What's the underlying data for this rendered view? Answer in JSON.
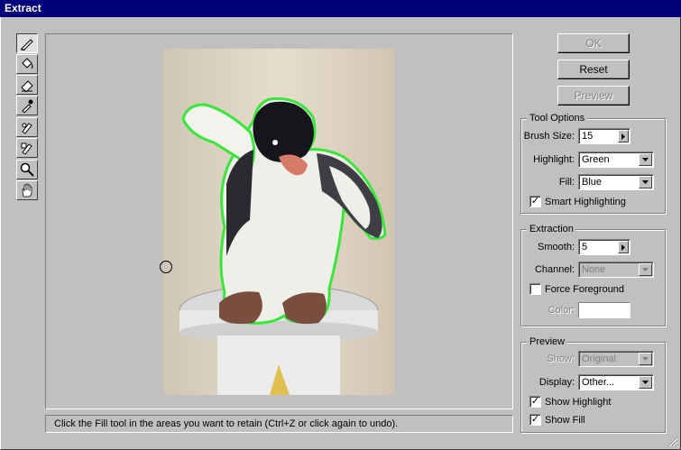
{
  "window": {
    "title": "Extract"
  },
  "tools": [
    {
      "name": "edge-highlighter-tool",
      "icon": "marker-icon"
    },
    {
      "name": "fill-tool",
      "icon": "paint-bucket-icon"
    },
    {
      "name": "eraser-tool",
      "icon": "eraser-icon"
    },
    {
      "name": "eyedropper-tool",
      "icon": "eyedropper-icon"
    },
    {
      "name": "cleanup-tool",
      "icon": "cleanup-icon"
    },
    {
      "name": "edge-touchup-tool",
      "icon": "edge-touchup-icon"
    },
    {
      "name": "zoom-tool",
      "icon": "magnifier-icon"
    },
    {
      "name": "hand-tool",
      "icon": "hand-icon"
    }
  ],
  "buttons": {
    "ok": "OK",
    "reset": "Reset",
    "preview": "Preview"
  },
  "tool_options": {
    "title": "Tool Options",
    "brush_size_label": "Brush Size:",
    "brush_size_value": "15",
    "highlight_label": "Highlight:",
    "highlight_value": "Green",
    "fill_label": "Fill:",
    "fill_value": "Blue",
    "smart_highlighting_label": "Smart Highlighting",
    "smart_highlighting_checked": true
  },
  "extraction": {
    "title": "Extraction",
    "smooth_label": "Smooth:",
    "smooth_value": "5",
    "channel_label": "Channel:",
    "channel_value": "None",
    "force_foreground_label": "Force Foreground",
    "force_foreground_checked": false,
    "color_label": "Color:"
  },
  "preview": {
    "title": "Preview",
    "show_label": "Show:",
    "show_value": "Original",
    "display_label": "Display:",
    "display_value": "Other...",
    "show_highlight_label": "Show Highlight",
    "show_highlight_checked": true,
    "show_fill_label": "Show Fill",
    "show_fill_checked": true
  },
  "status": {
    "text": "Click the Fill tool in the areas you want to retain (Ctrl+Z or click again to undo)."
  },
  "colors": {
    "titlebar": "#00007b",
    "highlight": "#39e63a",
    "dialog": "#c0c0c0"
  }
}
